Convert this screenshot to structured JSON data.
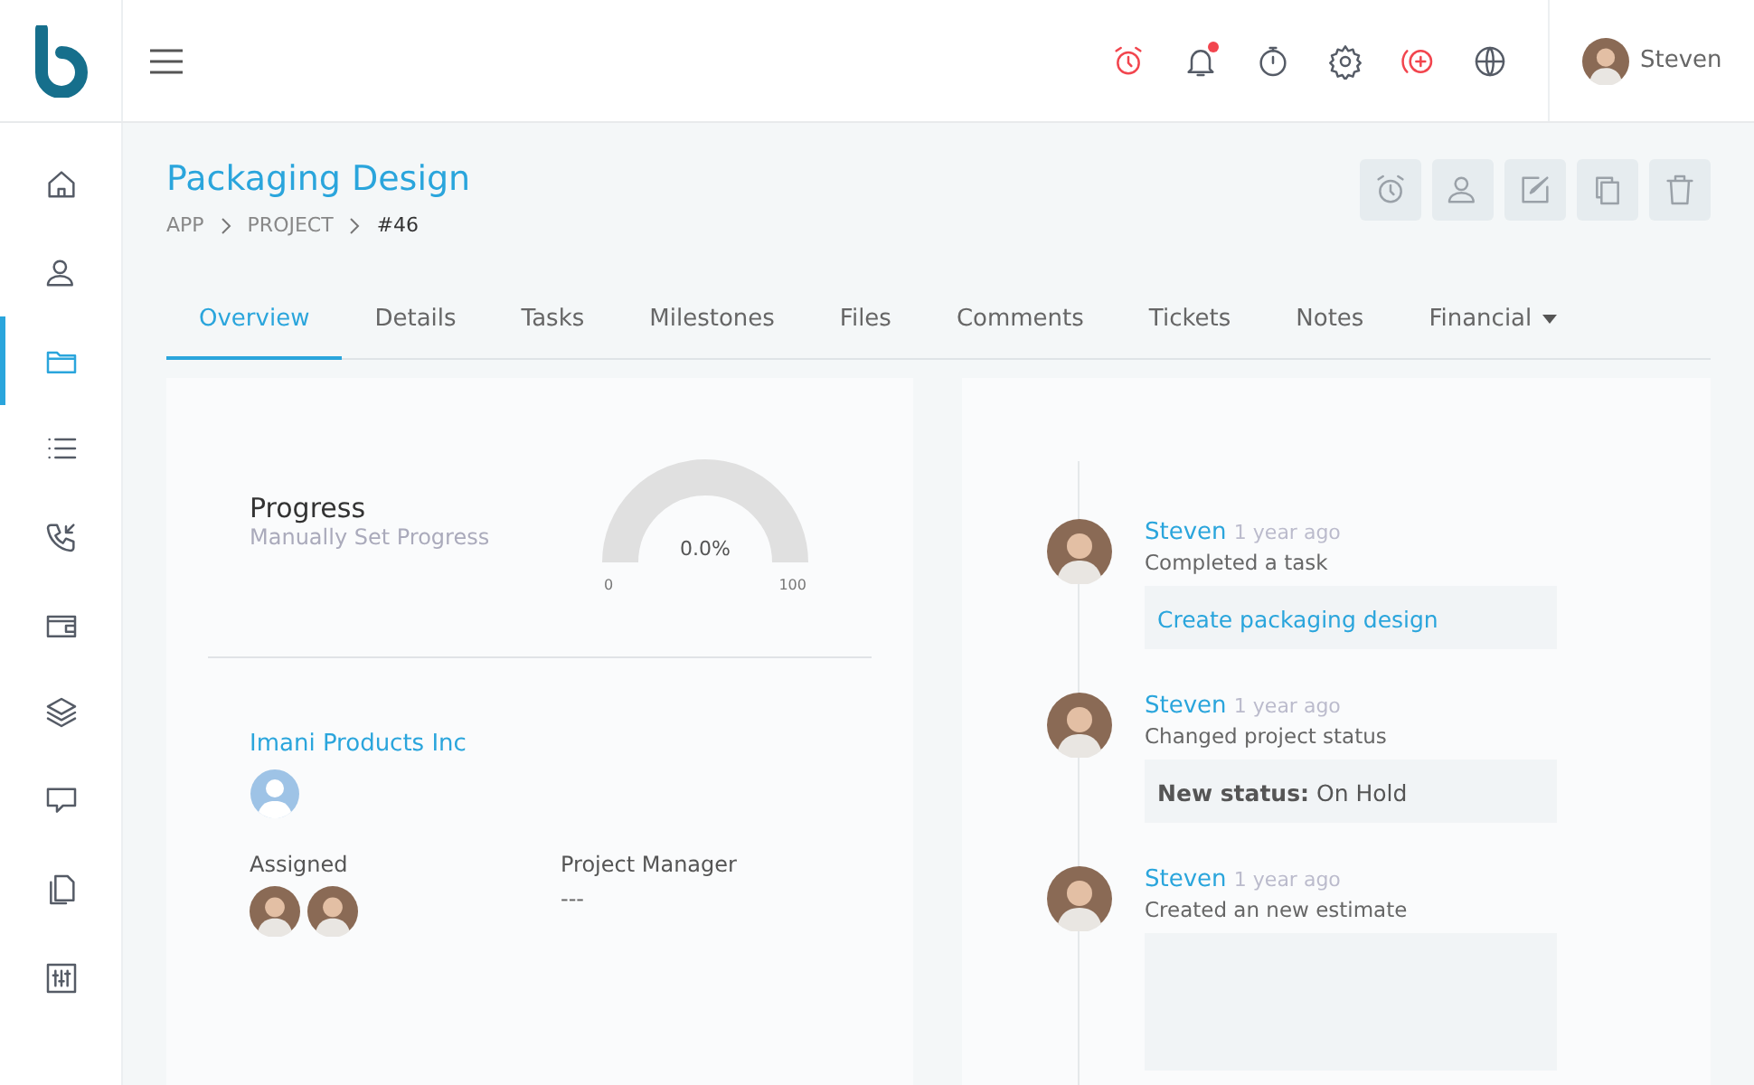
{
  "topbar": {
    "icons": [
      {
        "kind": "alarm",
        "alert": true
      },
      {
        "kind": "bell",
        "alert": true
      },
      {
        "kind": "stopwatch",
        "alert": false
      },
      {
        "kind": "gear",
        "alert": false
      },
      {
        "kind": "add",
        "alert": true
      },
      {
        "kind": "globe",
        "alert": false
      }
    ],
    "user": {
      "name": "Steven"
    }
  },
  "sidebar": {
    "items": [
      {
        "kind": "home",
        "selected": false
      },
      {
        "kind": "users",
        "selected": false
      },
      {
        "kind": "folder",
        "selected": true
      },
      {
        "kind": "list",
        "selected": false
      },
      {
        "kind": "phone",
        "selected": false
      },
      {
        "kind": "wallet",
        "selected": false
      },
      {
        "kind": "layers",
        "selected": false
      },
      {
        "kind": "chat",
        "selected": false
      },
      {
        "kind": "files",
        "selected": false
      },
      {
        "kind": "sliders",
        "selected": false
      }
    ]
  },
  "page": {
    "title": "Packaging Design",
    "breadcrumbs": [
      "APP",
      "PROJECT",
      "#46"
    ],
    "actions": [
      {
        "kind": "alarm"
      },
      {
        "kind": "user"
      },
      {
        "kind": "edit"
      },
      {
        "kind": "copy"
      },
      {
        "kind": "trash"
      }
    ]
  },
  "tabs": [
    {
      "label": "Overview",
      "selected": true,
      "dropdown": false
    },
    {
      "label": "Details",
      "selected": false,
      "dropdown": false
    },
    {
      "label": "Tasks",
      "selected": false,
      "dropdown": false
    },
    {
      "label": "Milestones",
      "selected": false,
      "dropdown": false
    },
    {
      "label": "Files",
      "selected": false,
      "dropdown": false
    },
    {
      "label": "Comments",
      "selected": false,
      "dropdown": false
    },
    {
      "label": "Tickets",
      "selected": false,
      "dropdown": false
    },
    {
      "label": "Notes",
      "selected": false,
      "dropdown": false
    },
    {
      "label": "Financial",
      "selected": false,
      "dropdown": true
    }
  ],
  "progress": {
    "title": "Progress",
    "subtitle": "Manually Set Progress",
    "reading": "0.0%",
    "min_label": "0",
    "max_label": "100"
  },
  "client": {
    "name": "Imani Products Inc"
  },
  "assigned": {
    "label": "Assigned",
    "members": [
      {
        "kind": "avatar"
      },
      {
        "kind": "avatar"
      }
    ]
  },
  "manager": {
    "label": "Project Manager",
    "value": "---"
  },
  "timeline": [
    {
      "user": "Steven",
      "time": "1 year ago",
      "action": "Completed a task",
      "kind": "link",
      "detail": "Create packaging design"
    },
    {
      "user": "Steven",
      "time": "1 year ago",
      "action": "Changed project status",
      "kind": "status",
      "detail_label": "New status:",
      "detail": "On Hold"
    },
    {
      "user": "Steven",
      "time": "1 year ago",
      "action": "Created an new estimate",
      "kind": "blank"
    }
  ]
}
